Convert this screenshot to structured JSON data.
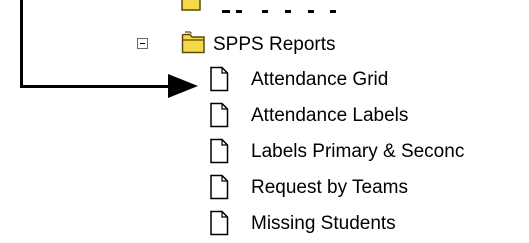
{
  "tree": {
    "folder": {
      "label": "SPPS Reports",
      "expanded": true,
      "icon": "open-folder-icon"
    },
    "items": [
      {
        "label": "Attendance Grid",
        "icon": "document-icon"
      },
      {
        "label": "Attendance Labels",
        "icon": "document-icon"
      },
      {
        "label": "Labels Primary & Seconc",
        "icon": "document-icon"
      },
      {
        "label": "Request by Teams",
        "icon": "document-icon"
      },
      {
        "label": "Missing Students",
        "icon": "document-icon"
      }
    ]
  },
  "colors": {
    "folder_fill": "#f5d94a",
    "folder_stroke": "#5a4a12",
    "arrow": "#000000"
  }
}
